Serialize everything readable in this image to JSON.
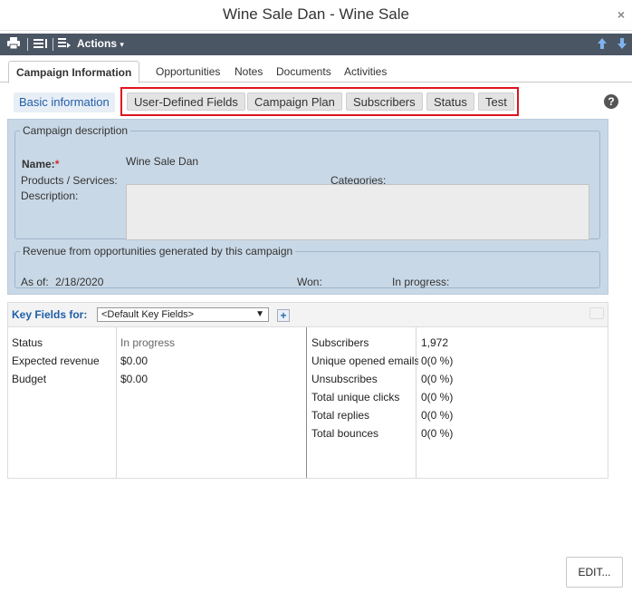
{
  "window": {
    "title": "Wine Sale Dan - Wine Sale",
    "close_glyph": "×"
  },
  "toolbar": {
    "icons": [
      "print-icon",
      "list-icon",
      "actions-menu-icon",
      "arrow-up-icon",
      "arrow-down-icon"
    ],
    "actions_label": "Actions",
    "colors": {
      "bar": "#4b5665",
      "nav_arrows": "#7fb2ee"
    }
  },
  "tabs": [
    {
      "label": "Campaign Information",
      "active": true
    },
    {
      "label": "Opportunities"
    },
    {
      "label": "Notes"
    },
    {
      "label": "Documents"
    },
    {
      "label": "Activities"
    }
  ],
  "subtabs": {
    "basic": "Basic information",
    "items": [
      "User-Defined Fields",
      "Campaign Plan",
      "Subscribers",
      "Status",
      "Test"
    ],
    "highlight_color": "#e0141e"
  },
  "help_glyph": "?",
  "campaign_description": {
    "legend": "Campaign description",
    "name_label": "Name:",
    "required_mark": "*",
    "name_value": "Wine Sale Dan",
    "products_label": "Products / Services:",
    "categories_label": "Categories:",
    "description_label": "Description:"
  },
  "revenue": {
    "legend": "Revenue from opportunities generated by this campaign",
    "as_of_label": "As of:",
    "as_of_value": "2/18/2020",
    "won_label": "Won:",
    "in_progress_label": "In progress:"
  },
  "key_fields": {
    "label": "Key Fields for:",
    "select_value": "<Default Key Fields>",
    "add_glyph": "+",
    "left": [
      {
        "label": "Status",
        "value": "In progress"
      },
      {
        "label": "Expected revenue",
        "value": "$0.00"
      },
      {
        "label": "Budget",
        "value": "$0.00"
      }
    ],
    "right": [
      {
        "label": "Subscribers",
        "value": "1,972"
      },
      {
        "label": "Unique opened emails",
        "value": "0(0 %)"
      },
      {
        "label": "Unsubscribes",
        "value": "0(0 %)"
      },
      {
        "label": "Total unique clicks",
        "value": "0(0 %)"
      },
      {
        "label": "Total replies",
        "value": "0(0 %)"
      },
      {
        "label": "Total bounces",
        "value": "0(0 %)"
      }
    ]
  },
  "edit_button": "EDIT..."
}
